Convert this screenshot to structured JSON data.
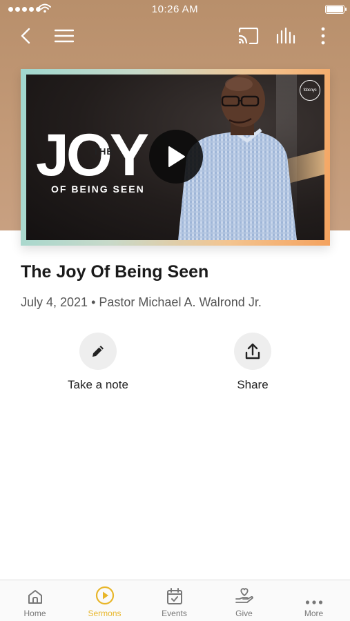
{
  "status_bar": {
    "time": "10:26 AM",
    "battery_level": 1.0
  },
  "nav": {
    "back_icon": "chevron-left-icon",
    "menu_icon": "hamburger-menu-icon",
    "cast_icon": "cast-icon",
    "audio_icon": "audio-bars-icon",
    "more_icon": "more-vertical-icon"
  },
  "thumbnail": {
    "title_main": "JOY",
    "title_small": "THE",
    "subtitle": "OF BEING SEEN",
    "logo_text": "fcbcnyc",
    "play_icon": "play-icon"
  },
  "sermon": {
    "title": "The Joy Of Being Seen",
    "date": "July 4, 2021",
    "separator": "•",
    "speaker": "Pastor Michael A. Walrond Jr."
  },
  "actions": [
    {
      "label": "Take a note",
      "icon": "pencil-icon"
    },
    {
      "label": "Share",
      "icon": "share-upload-icon"
    }
  ],
  "tabs": [
    {
      "label": "Home",
      "icon": "home-icon",
      "active": false
    },
    {
      "label": "Sermons",
      "icon": "play-circle-icon",
      "active": true
    },
    {
      "label": "Events",
      "icon": "calendar-check-icon",
      "active": false
    },
    {
      "label": "Give",
      "icon": "give-hand-heart-icon",
      "active": false
    },
    {
      "label": "More",
      "icon": "more-horizontal-icon",
      "active": false
    }
  ],
  "colors": {
    "accent": "#e8b62a",
    "hero_bg": "#c39a78",
    "tab_inactive": "#777777"
  }
}
